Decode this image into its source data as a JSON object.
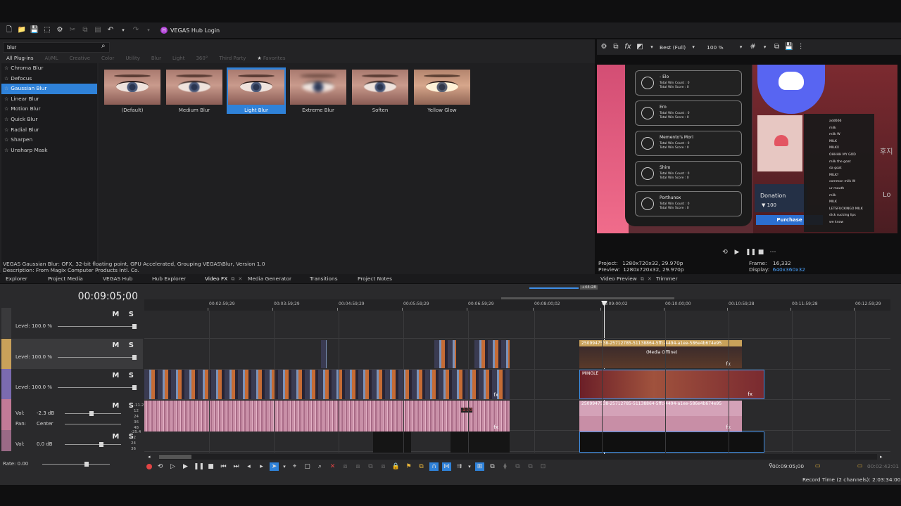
{
  "app": {
    "hub_login_label": "VEGAS Hub Login"
  },
  "plugins": {
    "search_value": "blur",
    "filter_tabs": [
      "All Plug-ins",
      "AI/ML",
      "Creative",
      "Color",
      "Utility",
      "Blur",
      "Light",
      "360°",
      "Third Party",
      "Favorites"
    ],
    "list": [
      "Chroma Blur",
      "Defocus",
      "Gaussian Blur",
      "Linear Blur",
      "Motion Blur",
      "Quick Blur",
      "Radial Blur",
      "Sharpen",
      "Unsharp Mask"
    ],
    "selected_index": 2,
    "presets": [
      "(Default)",
      "Medium Blur",
      "Light Blur",
      "Extreme Blur",
      "Soften",
      "Yellow Glow"
    ],
    "selected_preset": "Light Blur",
    "description_line1": "VEGAS Gaussian Blur: OFX, 32-bit floating point, GPU Accelerated, Grouping VEGAS\\Blur, Version 1.0",
    "description_line2": "Description: From Magix Computer Products Intl. Co."
  },
  "preview": {
    "quality": "Best (Full)",
    "zoom": "100 %",
    "project_label": "Project:",
    "project_value": "1280x720x32, 29.970p",
    "preview_label": "Preview:",
    "preview_value": "1280x720x32, 29.970p",
    "frame_label": "Frame:",
    "frame_value": "16,332",
    "display_label": "Display:",
    "display_value": "640x360x32",
    "video": {
      "players": [
        {
          "name": "- Elo",
          "stats": "Total Win Count : 0\nTotal Win Score : 0"
        },
        {
          "name": "Ero",
          "stats": "Total Win Count : 0\nTotal Win Score : 0"
        },
        {
          "name": "Memento's Mori",
          "stats": "Total Win Count : 0\nTotal Win Score : 0"
        },
        {
          "name": "Shiro",
          "stats": "Total Win Count : 0\nTotal Win Score : 0"
        },
        {
          "name": "Porthunox",
          "stats": "Total Win Count : 0\nTotal Win Score : 0"
        }
      ],
      "donation_label": "Donation",
      "donation_value": "100",
      "purchase_label": "Purchase",
      "chat": [
        "add666",
        "milk",
        "milk W",
        "MILK",
        "MILKX",
        "OHHHH MY GOD",
        "milk the goat",
        "da goat",
        "MILK?",
        "common milk W",
        "ur mouth",
        "milk",
        "MILK",
        "LETSFUCKINGO MILK",
        "dick sucking lips",
        "we know"
      ],
      "korean_1": "후지",
      "korean_2": "Lo"
    }
  },
  "dock_tabs_left": [
    "Explorer",
    "Project Media",
    "VEGAS Hub",
    "Hub Explorer",
    "Video FX",
    "Media Generator",
    "Transitions",
    "Project Notes"
  ],
  "dock_tabs_right": [
    "Video Preview",
    "Trimmer"
  ],
  "timeline": {
    "timecode": "00:09:05;00",
    "ruler_labels": [
      "00:02:59;29",
      "00:03:59;29",
      "00:04:59;29",
      "00:05:59;29",
      "00:06:59;29",
      "00:08:00;02",
      "00:09:00;02",
      "00:10:00;00",
      "00:10:59;28",
      "00:11:59;28",
      "00:12:59;29"
    ],
    "loop_length": "+44:28",
    "tracks": [
      {
        "type": "video",
        "level": "Level: 100.0 %",
        "ms": "M S"
      },
      {
        "type": "video",
        "level": "Level: 100.0 %",
        "ms": "M S"
      },
      {
        "type": "video",
        "level": "Level: 100.0 %",
        "ms": "M S"
      },
      {
        "type": "audio",
        "vol_label": "Vol:",
        "vol_value": "-2.3 dB",
        "pan_label": "Pan:",
        "pan_value": "Center",
        "ms": "M S"
      },
      {
        "type": "audio",
        "vol_label": "Vol:",
        "vol_value": "0.0 dB",
        "ms": "M S"
      }
    ],
    "clip_title_top": "2509947538-25712785-51138864-5ffc-4494-a1ee-586e4b674e95",
    "clip_offline_label": "(Media Offline)",
    "clip_mingle": "MINGLE",
    "audio_marker": "-1:10",
    "meter_ticks_a": [
      "-11.2",
      "12",
      "24",
      "36",
      "48"
    ],
    "meter_ticks_b": [
      "-25.4",
      "12",
      "24",
      "36"
    ],
    "rate": "Rate: 0.00",
    "cursor_time": "00:09:05;00",
    "end_time": "00:02:42:01",
    "record_time": "Record Time (2 channels): 2:03:34:00"
  }
}
